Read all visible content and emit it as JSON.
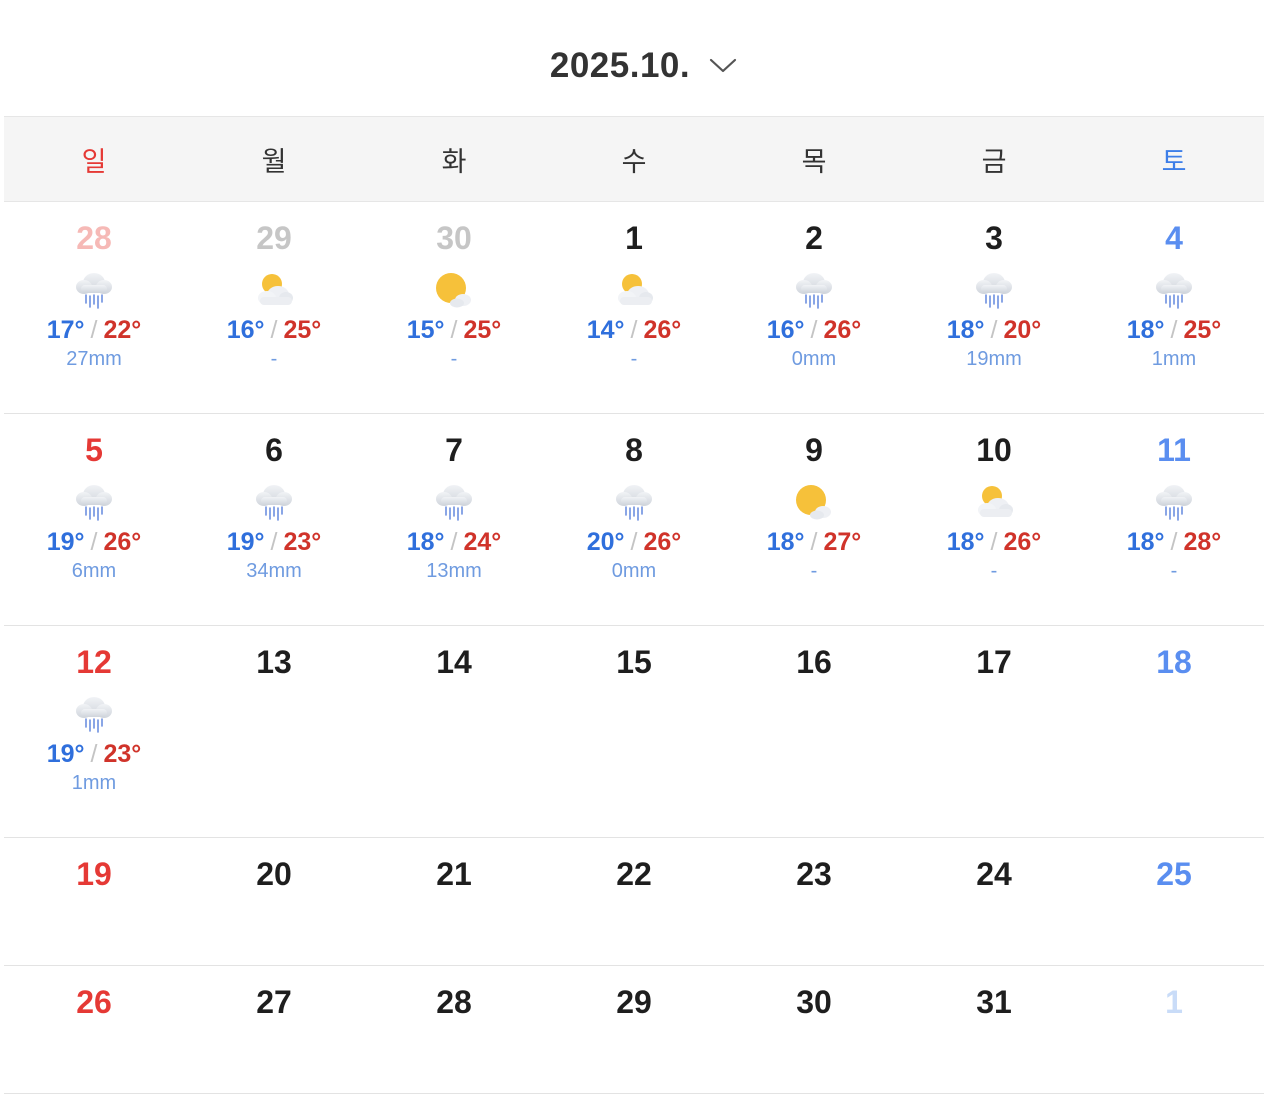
{
  "header": {
    "title": "2025.10."
  },
  "weekdays": [
    "일",
    "월",
    "화",
    "수",
    "목",
    "금",
    "토"
  ],
  "weeks": [
    [
      {
        "day": "28",
        "other": true,
        "icon": "rain",
        "low": "17°",
        "high": "22°",
        "precip": "27mm"
      },
      {
        "day": "29",
        "other": true,
        "icon": "partly-cloudy",
        "low": "16°",
        "high": "25°",
        "precip": "-"
      },
      {
        "day": "30",
        "other": true,
        "icon": "sun-cloud",
        "low": "15°",
        "high": "25°",
        "precip": "-"
      },
      {
        "day": "1",
        "icon": "partly-cloudy",
        "low": "14°",
        "high": "26°",
        "precip": "-"
      },
      {
        "day": "2",
        "icon": "rain",
        "low": "16°",
        "high": "26°",
        "precip": "0mm"
      },
      {
        "day": "3",
        "icon": "rain",
        "low": "18°",
        "high": "20°",
        "precip": "19mm"
      },
      {
        "day": "4",
        "icon": "rain",
        "low": "18°",
        "high": "25°",
        "precip": "1mm"
      }
    ],
    [
      {
        "day": "5",
        "icon": "rain",
        "low": "19°",
        "high": "26°",
        "precip": "6mm"
      },
      {
        "day": "6",
        "icon": "rain",
        "low": "19°",
        "high": "23°",
        "precip": "34mm"
      },
      {
        "day": "7",
        "icon": "rain",
        "low": "18°",
        "high": "24°",
        "precip": "13mm"
      },
      {
        "day": "8",
        "icon": "rain",
        "low": "20°",
        "high": "26°",
        "precip": "0mm"
      },
      {
        "day": "9",
        "icon": "sun-cloud",
        "low": "18°",
        "high": "27°",
        "precip": "-"
      },
      {
        "day": "10",
        "icon": "partly-cloudy",
        "low": "18°",
        "high": "26°",
        "precip": "-"
      },
      {
        "day": "11",
        "icon": "rain",
        "low": "18°",
        "high": "28°",
        "precip": "-"
      }
    ],
    [
      {
        "day": "12",
        "icon": "rain",
        "low": "19°",
        "high": "23°",
        "precip": "1mm"
      },
      {
        "day": "13"
      },
      {
        "day": "14"
      },
      {
        "day": "15"
      },
      {
        "day": "16"
      },
      {
        "day": "17"
      },
      {
        "day": "18"
      }
    ],
    [
      {
        "day": "19"
      },
      {
        "day": "20"
      },
      {
        "day": "21"
      },
      {
        "day": "22"
      },
      {
        "day": "23"
      },
      {
        "day": "24"
      },
      {
        "day": "25"
      }
    ],
    [
      {
        "day": "26"
      },
      {
        "day": "27"
      },
      {
        "day": "28"
      },
      {
        "day": "29"
      },
      {
        "day": "30"
      },
      {
        "day": "31"
      },
      {
        "day": "1",
        "other": true
      }
    ]
  ],
  "colors": {
    "sunday": "#e53935",
    "saturday": "#3d7ee8",
    "low": "#2f6fdc",
    "high": "#d0332a",
    "precip": "#6f9be0"
  }
}
